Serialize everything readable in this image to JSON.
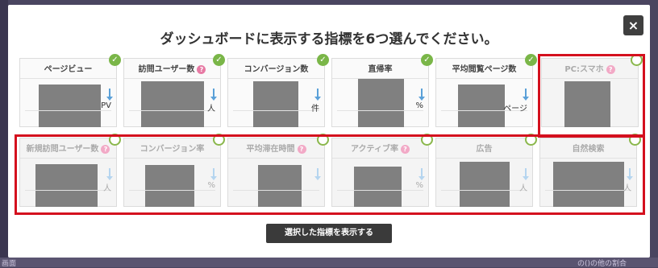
{
  "modal": {
    "title": "ダッシュボードに表示する指標を6つ選んでください。",
    "close_label": "×",
    "submit_label": "選択した指標を表示する"
  },
  "check_mark": "✓",
  "help_mark": "?",
  "colors": {
    "check_green": "#7ab648",
    "highlight_red": "#d4101e",
    "help_pink": "#e77aa4",
    "arrow_blue": "#5aa0d8",
    "button_dark": "#3a3a3a"
  },
  "metrics_row1": [
    {
      "label": "ページビュー",
      "unit": "PV",
      "selected": true,
      "help": false
    },
    {
      "label": "訪問ユーザー数",
      "unit": "人",
      "selected": true,
      "help": true
    },
    {
      "label": "コンバージョン数",
      "unit": "件",
      "selected": true,
      "help": false
    },
    {
      "label": "直帰率",
      "unit": "%",
      "selected": true,
      "help": false
    },
    {
      "label": "平均閲覧ページ数",
      "unit": "ページ",
      "selected": true,
      "help": false
    },
    {
      "label": "PC:スマホ",
      "unit": "",
      "selected": false,
      "help": true
    }
  ],
  "metrics_row2": [
    {
      "label": "新規訪問ユーザー数",
      "unit": "人",
      "selected": false,
      "help": true
    },
    {
      "label": "コンバージョン率",
      "unit": "%",
      "selected": false,
      "help": false
    },
    {
      "label": "平均滞在時間",
      "unit": "",
      "selected": false,
      "help": true
    },
    {
      "label": "アクティブ率",
      "unit": "%",
      "selected": false,
      "help": true
    },
    {
      "label": "広告",
      "unit": "人",
      "selected": false,
      "help": false
    },
    {
      "label": "自然検索",
      "unit": "人",
      "selected": false,
      "help": false
    }
  ],
  "background_fragments": {
    "left": "画面",
    "right": "の()の他の割合"
  }
}
